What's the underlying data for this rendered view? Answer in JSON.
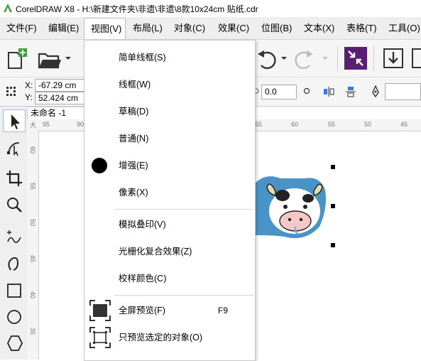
{
  "window": {
    "title": "CorelDRAW X8 - H:\\新建文件夹\\非遗\\非遗\\8款10x24cm 贴纸.cdr"
  },
  "menubar": {
    "items": [
      {
        "label": "文件(F)"
      },
      {
        "label": "编辑(E)"
      },
      {
        "label": "视图(V)"
      },
      {
        "label": "布局(L)"
      },
      {
        "label": "对象(C)"
      },
      {
        "label": "效果(C)"
      },
      {
        "label": "位图(B)"
      },
      {
        "label": "文本(X)"
      },
      {
        "label": "表格(T)"
      },
      {
        "label": "工具(O)"
      }
    ]
  },
  "propbar": {
    "x_label": "X:",
    "y_label": "Y:",
    "x_value": "-67.29 cm",
    "y_value": "52.424 cm",
    "angle_value": "0.0"
  },
  "document": {
    "tab_label": "未命名 -1"
  },
  "rulers": {
    "top_ticks": [
      "95",
      "90",
      "65",
      "60",
      "55",
      "50",
      "45"
    ],
    "left_ticks": [
      "60",
      "55",
      "50",
      "45",
      "40",
      "35"
    ],
    "top_corner": "大"
  },
  "view_menu": {
    "items": [
      {
        "label": "简单线框(S)"
      },
      {
        "label": "线框(W)"
      },
      {
        "label": "草稿(D)"
      },
      {
        "label": "普通(N)"
      },
      {
        "label": "增强(E)"
      },
      {
        "label": "像素(X)"
      },
      {
        "label": "模拟叠印(V)"
      },
      {
        "label": "光栅化复合效果(Z)"
      },
      {
        "label": "校样颜色(C)"
      },
      {
        "label": "全屏预览(F)",
        "shortcut": "F9"
      },
      {
        "label": "只预览选定的对象(O)"
      }
    ],
    "selected": "增强(E)"
  },
  "colors": {
    "accent_purple": "#5a1f73",
    "logo_green": "#3ba23b",
    "sticker_blue": "#4a93c6"
  }
}
